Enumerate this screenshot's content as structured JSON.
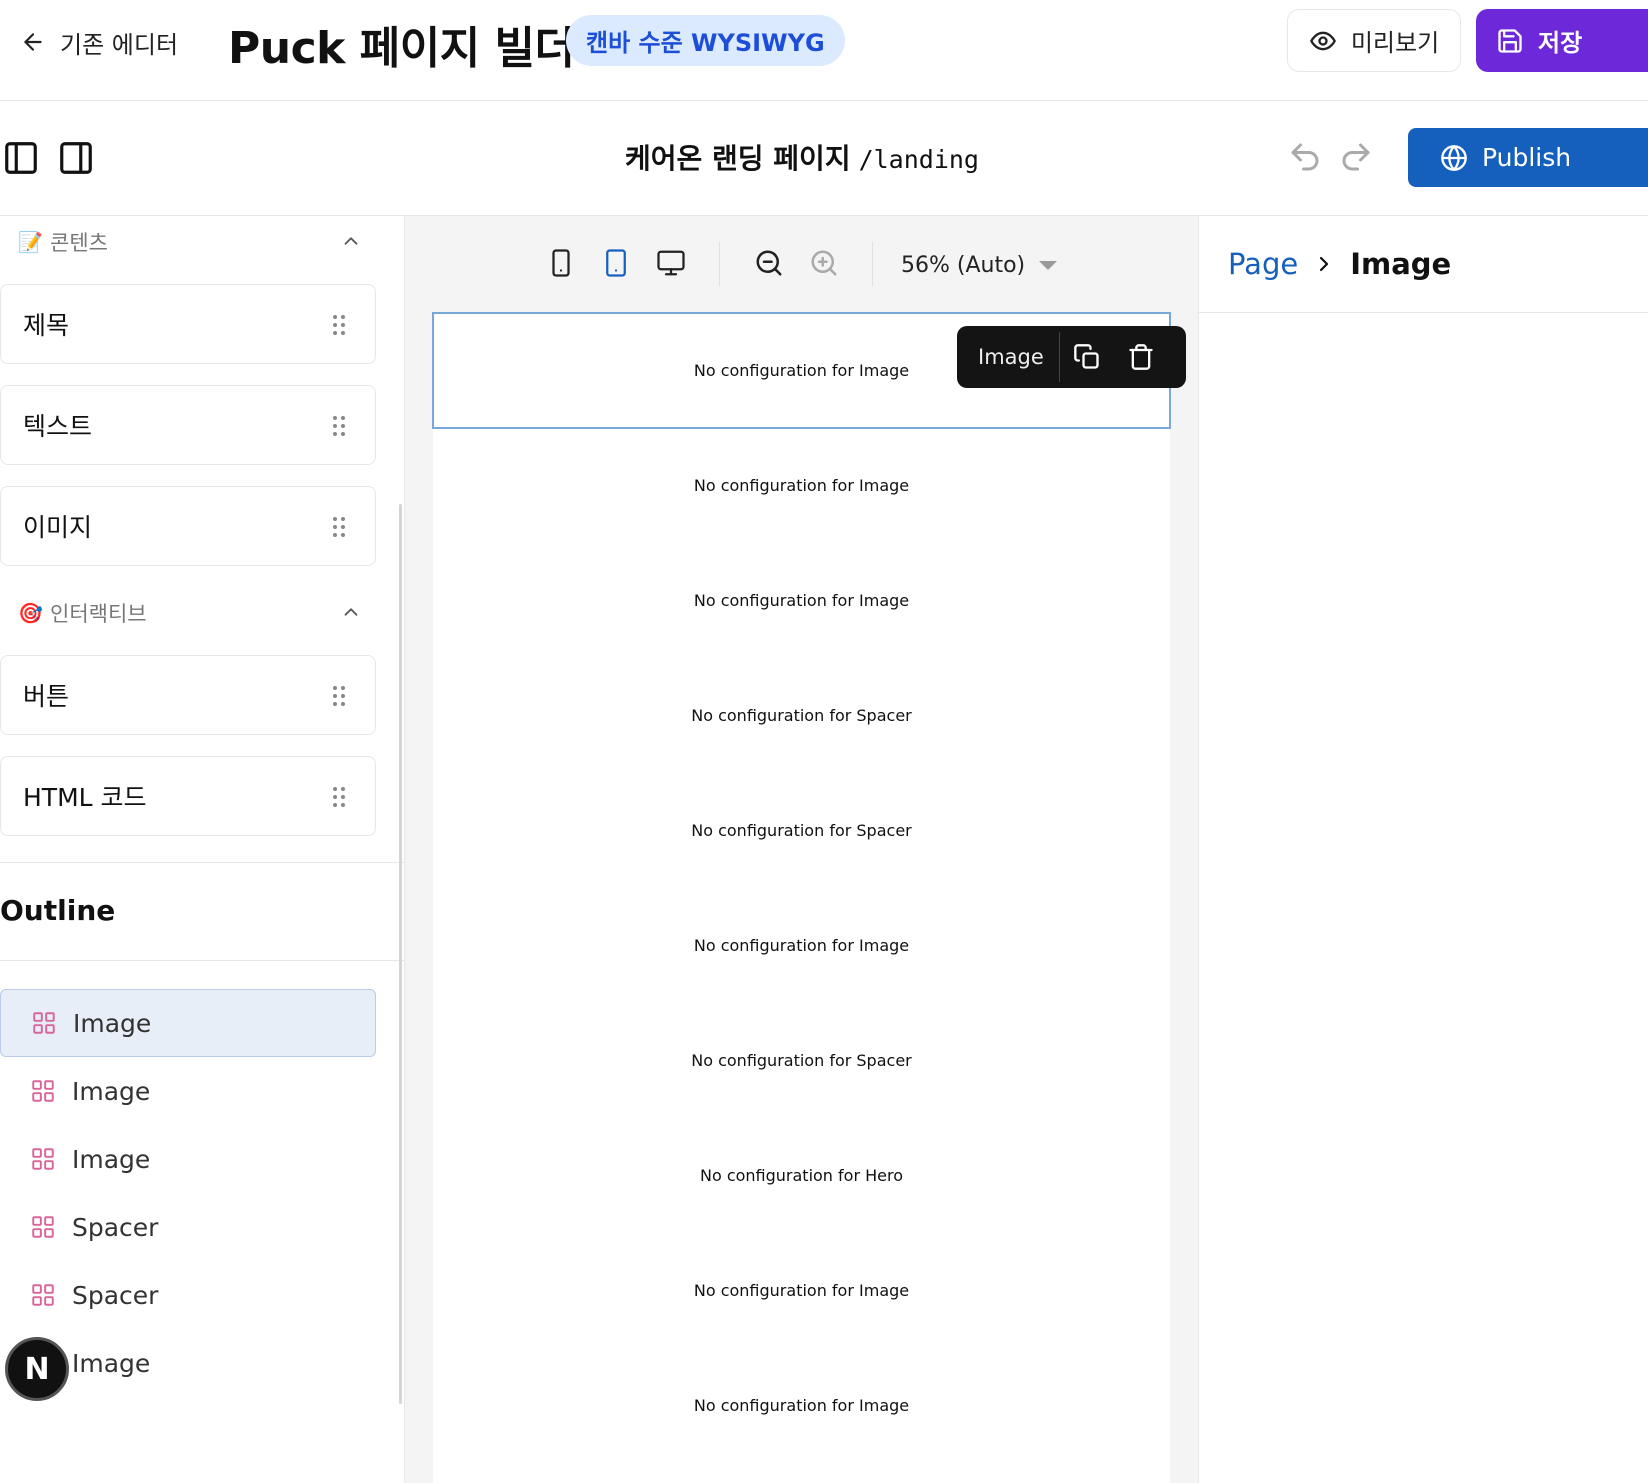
{
  "header": {
    "back_label": "기존 에디터",
    "title": "Puck 페이지 빌더",
    "badge": "캔바 수준 WYSIWYG",
    "preview_label": "미리보기",
    "save_label": "저장"
  },
  "puck_header": {
    "page_name": "케어온 랜딩 페이지",
    "page_path": "/landing",
    "publish_label": "Publish"
  },
  "components": {
    "categories": [
      {
        "icon": "memo-emoji",
        "label": "콘텐츠",
        "items": [
          "제목",
          "텍스트",
          "이미지"
        ]
      },
      {
        "icon": "target-emoji",
        "label": "인터랙티브",
        "items": [
          "버튼",
          "HTML 코드"
        ]
      }
    ]
  },
  "outline": {
    "title": "Outline",
    "items": [
      "Image",
      "Image",
      "Image",
      "Spacer",
      "Spacer",
      "Image"
    ],
    "selected_index": 0
  },
  "canvas": {
    "zoom_label": "56% (Auto)",
    "blocks": [
      "No configuration for Image",
      "No configuration for Image",
      "No configuration for Image",
      "No configuration for Spacer",
      "No configuration for Spacer",
      "No configuration for Image",
      "No configuration for Spacer",
      "No configuration for Hero",
      "No configuration for Image",
      "No configuration for Image"
    ],
    "action_bar_label": "Image"
  },
  "right_panel": {
    "breadcrumb_root": "Page",
    "breadcrumb_current": "Image"
  },
  "dev_badge": {
    "letter": "N"
  },
  "colors": {
    "save_button": "#6d28d9",
    "publish_button": "#1660bd",
    "badge_bg": "#dbeafe",
    "badge_text": "#1d4ed8",
    "selection_outline": "#7aa7d9"
  }
}
